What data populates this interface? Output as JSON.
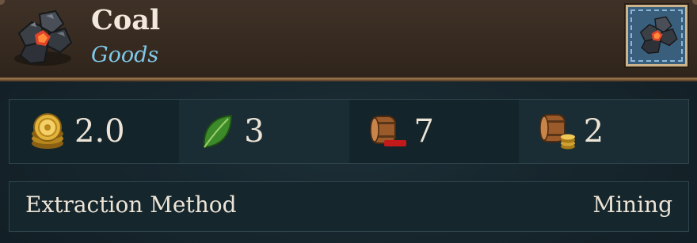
{
  "header": {
    "title": "Coal",
    "subtitle": "Goods",
    "icon": "coal-icon",
    "thumbnail_icon": "coal-thumbnail-icon"
  },
  "stats": [
    {
      "icon": "gold-coins-icon",
      "value": "2.0"
    },
    {
      "icon": "leaf-icon",
      "value": "3"
    },
    {
      "icon": "barrel-minus-icon",
      "value": "7"
    },
    {
      "icon": "barrel-coins-icon",
      "value": "2"
    }
  ],
  "extraction": {
    "label": "Extraction Method",
    "value": "Mining"
  },
  "colors": {
    "title": "#f2e9dc",
    "subtitle": "#7fc8e8",
    "header_bg": "#3a2d22",
    "panel_bg": "#15232a"
  }
}
